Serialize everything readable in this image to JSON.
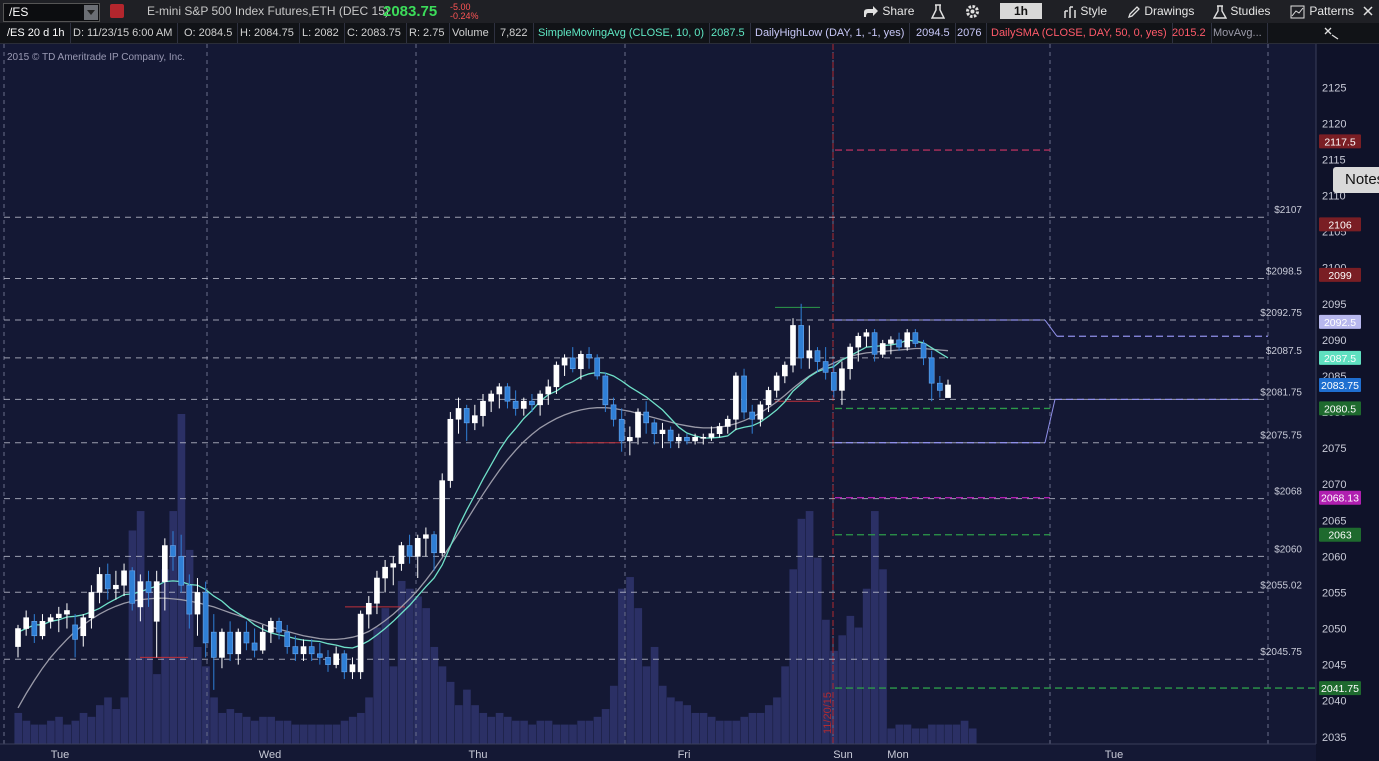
{
  "toolbar": {
    "symbol": "/ES",
    "description": "E-mini S&P 500 Index Futures,ETH (DEC 15)",
    "last_price": "2083.75",
    "net_change": "-5.00",
    "pct_change": "-0.24%",
    "share_label": "Share",
    "timeframe": "1h",
    "style_label": "Style",
    "drawings_label": "Drawings",
    "studies_label": "Studies",
    "patterns_label": "Patterns"
  },
  "status": {
    "period": "/ES 20 d 1h",
    "date": "D: 11/23/15 6:00 AM",
    "open": "O: 2084.5",
    "high": "H: 2084.75",
    "low": "L: 2082",
    "close": "C: 2083.75",
    "range": "R: 2.75",
    "volume_label": "Volume",
    "volume_value": "7,822",
    "sma_label": "SimpleMovingAvg (CLOSE, 10, 0)",
    "sma_value": "2087.5",
    "dhl_label": "DailyHighLow (DAY, 1, -1, yes)",
    "dhl_high": "2094.5",
    "dhl_low": "2076",
    "dsma_label": "DailySMA (CLOSE, DAY, 50, 0, yes)",
    "dsma_value": "2015.2",
    "movavg_label": "MovAvg..."
  },
  "copyright": "2015 © TD Ameritrade IP Company, Inc.",
  "notes_label": "Notes",
  "colors": {
    "background": "#141834",
    "up_candle": "#ffffff",
    "down_candle": "#2f7fd6",
    "volume": "#2b3065",
    "sma10": "#6fe0c8",
    "sma_slow": "#9a9aa8",
    "red_marker": "#c0303a",
    "green_marker": "#2c9a4a"
  },
  "chart_data": {
    "type": "candlestick",
    "symbol": "/ES",
    "interval": "1h",
    "ylim": [
      2034,
      2131
    ],
    "y_ticks": [
      2035,
      2040,
      2045,
      2050,
      2055,
      2060,
      2065,
      2070,
      2075,
      2080,
      2085,
      2090,
      2095,
      2100,
      2105,
      2110,
      2115,
      2120,
      2125
    ],
    "x_ticks": [
      "Tue",
      "Wed",
      "Thu",
      "Fri",
      "Sun",
      "Mon",
      "Tue"
    ],
    "date_marker": "11/20/15",
    "levels": [
      {
        "label": "$2107",
        "value": 2107
      },
      {
        "label": "$2098.5",
        "value": 2098.5
      },
      {
        "label": "$2092.75",
        "value": 2092.75
      },
      {
        "label": "$2087.5",
        "value": 2087.5
      },
      {
        "label": "$2081.75",
        "value": 2081.75
      },
      {
        "label": "$2075.75",
        "value": 2075.75
      },
      {
        "label": "$2068",
        "value": 2068
      },
      {
        "label": "$2060",
        "value": 2060
      },
      {
        "label": "$2055.02",
        "value": 2055.02
      },
      {
        "label": "$2045.75",
        "value": 2045.75
      }
    ],
    "price_tags": [
      {
        "label": "2117.5",
        "value": 2117.5,
        "color": "#7a1e24"
      },
      {
        "label": "2106",
        "value": 2106,
        "color": "#7a1e24"
      },
      {
        "label": "2099",
        "value": 2099,
        "color": "#7a1e24"
      },
      {
        "label": "2092.5",
        "value": 2092.5,
        "color": "#b8b8ee"
      },
      {
        "label": "2087.5",
        "value": 2087.5,
        "color": "#5fe0c0"
      },
      {
        "label": "2083.75",
        "value": 2083.75,
        "color": "#1f6fd0"
      },
      {
        "label": "2080.5",
        "value": 2080.5,
        "color": "#1e6a2e"
      },
      {
        "label": "2068.13",
        "value": 2068.13,
        "color": "#b01fb0"
      },
      {
        "label": "2063",
        "value": 2063,
        "color": "#1e6a2e"
      },
      {
        "label": "2041.75",
        "value": 2041.75,
        "color": "#1e6a2e"
      }
    ],
    "candles": [
      [
        2047.5,
        2050.5,
        2046,
        2050
      ],
      [
        2050,
        2052.5,
        2049,
        2051.5
      ],
      [
        2051,
        2052,
        2048,
        2049
      ],
      [
        2049,
        2052,
        2048.5,
        2051
      ],
      [
        2051,
        2052,
        2050,
        2051.5
      ],
      [
        2051.5,
        2053,
        2049.5,
        2052
      ],
      [
        2052,
        2053.5,
        2050,
        2052.5
      ],
      [
        2050.5,
        2052,
        2046,
        2048.5
      ],
      [
        2049,
        2052,
        2047.5,
        2051.5
      ],
      [
        2051.5,
        2056,
        2050,
        2055
      ],
      [
        2055,
        2058.5,
        2053.5,
        2057.5
      ],
      [
        2057.5,
        2059,
        2054,
        2055.5
      ],
      [
        2055.5,
        2058,
        2054,
        2056
      ],
      [
        2056,
        2059,
        2054.5,
        2058
      ],
      [
        2058,
        2058.5,
        2052.5,
        2053.5
      ],
      [
        2053,
        2057.5,
        2051,
        2056.5
      ],
      [
        2056.5,
        2058,
        2053,
        2055
      ],
      [
        2051,
        2058,
        2046,
        2056.5
      ],
      [
        2056.5,
        2062.5,
        2052.5,
        2061.5
      ],
      [
        2061.5,
        2063.5,
        2058,
        2060
      ],
      [
        2060,
        2063,
        2055,
        2056
      ],
      [
        2056,
        2057.5,
        2050,
        2052
      ],
      [
        2052,
        2057,
        2049,
        2055
      ],
      [
        2055,
        2056.5,
        2046,
        2048
      ],
      [
        2049.5,
        2052,
        2041.5,
        2046
      ],
      [
        2046,
        2050,
        2044.5,
        2049.5
      ],
      [
        2049.5,
        2051,
        2045.5,
        2046.5
      ],
      [
        2046.5,
        2050,
        2045,
        2049.5
      ],
      [
        2049.5,
        2051,
        2047,
        2048
      ],
      [
        2048,
        2050,
        2046,
        2047
      ],
      [
        2047,
        2050.5,
        2046.5,
        2049.5
      ],
      [
        2049.5,
        2051.5,
        2048,
        2051
      ],
      [
        2051,
        2051.5,
        2048.5,
        2049.5
      ],
      [
        2049.5,
        2050.5,
        2046.5,
        2047.5
      ],
      [
        2047.5,
        2049,
        2045.5,
        2046.5
      ],
      [
        2046.5,
        2048.5,
        2045.5,
        2047.5
      ],
      [
        2047.5,
        2048.5,
        2045.5,
        2046.5
      ],
      [
        2046.5,
        2048,
        2045,
        2046
      ],
      [
        2046,
        2047,
        2044,
        2045
      ],
      [
        2045,
        2047.5,
        2044.5,
        2046.5
      ],
      [
        2046.5,
        2047,
        2043,
        2044
      ],
      [
        2044,
        2046,
        2043,
        2045
      ],
      [
        2044,
        2052.5,
        2043,
        2052
      ],
      [
        2052,
        2054.5,
        2050,
        2053.5
      ],
      [
        2053.5,
        2058,
        2052,
        2057
      ],
      [
        2057,
        2059.5,
        2055,
        2058.5
      ],
      [
        2058.5,
        2060,
        2056,
        2059
      ],
      [
        2059,
        2062,
        2058,
        2061.5
      ],
      [
        2061.5,
        2063,
        2059,
        2060
      ],
      [
        2060,
        2063,
        2057,
        2062.5
      ],
      [
        2062.5,
        2064,
        2060,
        2063
      ],
      [
        2063,
        2063.5,
        2058,
        2060.5
      ],
      [
        2060.5,
        2071.5,
        2060,
        2070.5
      ],
      [
        2070.5,
        2080,
        2069.5,
        2079
      ],
      [
        2079,
        2082,
        2077,
        2080.5
      ],
      [
        2080.5,
        2081,
        2076,
        2078.5
      ],
      [
        2078.5,
        2081,
        2077.5,
        2079.5
      ],
      [
        2079.5,
        2082.5,
        2078,
        2081.5
      ],
      [
        2081.5,
        2083,
        2080,
        2082.5
      ],
      [
        2082.5,
        2084,
        2080.5,
        2083.5
      ],
      [
        2083.5,
        2084,
        2080.5,
        2081.5
      ],
      [
        2081.5,
        2083,
        2079.5,
        2080.5
      ],
      [
        2080.5,
        2082,
        2079.5,
        2081.5
      ],
      [
        2081.5,
        2082.5,
        2080,
        2081
      ],
      [
        2081,
        2083,
        2079.5,
        2082.5
      ],
      [
        2082.5,
        2084.5,
        2081,
        2083.5
      ],
      [
        2083.5,
        2087,
        2082.5,
        2086.5
      ],
      [
        2086.5,
        2088,
        2085,
        2087.5
      ],
      [
        2087.5,
        2089,
        2085.5,
        2086
      ],
      [
        2086,
        2088.5,
        2084.5,
        2088
      ],
      [
        2088,
        2089,
        2086,
        2087.5
      ],
      [
        2087.5,
        2088,
        2084.5,
        2085
      ],
      [
        2085,
        2085.5,
        2080,
        2081
      ],
      [
        2081,
        2082,
        2078,
        2079
      ],
      [
        2079,
        2080.5,
        2074.5,
        2076
      ],
      [
        2076,
        2078,
        2074,
        2076.5
      ],
      [
        2076.5,
        2080.5,
        2075.5,
        2080
      ],
      [
        2080,
        2081.5,
        2077,
        2078.5
      ],
      [
        2078.5,
        2079,
        2075.5,
        2077
      ],
      [
        2077,
        2078.5,
        2075,
        2077.5
      ],
      [
        2077.5,
        2078,
        2075,
        2076
      ],
      [
        2076,
        2077,
        2075,
        2076.5
      ],
      [
        2076.5,
        2077,
        2075.5,
        2076
      ],
      [
        2076,
        2077,
        2075.5,
        2076.5
      ],
      [
        2076.5,
        2077,
        2075.5,
        2076.5
      ],
      [
        2076.5,
        2078,
        2076,
        2077
      ],
      [
        2077,
        2078.5,
        2076.5,
        2078
      ],
      [
        2078,
        2079.5,
        2077,
        2079
      ],
      [
        2079,
        2085.5,
        2077.5,
        2085
      ],
      [
        2085,
        2086,
        2079,
        2080
      ],
      [
        2080,
        2081,
        2077,
        2079
      ],
      [
        2079,
        2081.5,
        2078,
        2081
      ],
      [
        2081,
        2083.5,
        2080,
        2083
      ],
      [
        2083,
        2085.5,
        2082,
        2085
      ],
      [
        2085,
        2087,
        2084,
        2086.5
      ],
      [
        2086.5,
        2093,
        2085.5,
        2092
      ],
      [
        2092,
        2095,
        2086,
        2087.5
      ],
      [
        2087.5,
        2092,
        2086,
        2088.5
      ],
      [
        2088.5,
        2089,
        2085.5,
        2087
      ],
      [
        2087,
        2089,
        2084.5,
        2085.5
      ],
      [
        2085.5,
        2087,
        2082,
        2083
      ],
      [
        2083,
        2087,
        2081,
        2086
      ],
      [
        2086,
        2089.5,
        2084.5,
        2089
      ],
      [
        2089,
        2091,
        2087,
        2090.5
      ],
      [
        2090.5,
        2091.5,
        2089,
        2091
      ],
      [
        2091,
        2091.5,
        2087,
        2088
      ],
      [
        2088,
        2090,
        2087.5,
        2089.5
      ],
      [
        2089.5,
        2090.5,
        2088,
        2090
      ],
      [
        2090,
        2091,
        2088.5,
        2089
      ],
      [
        2089,
        2091.5,
        2088.5,
        2091
      ],
      [
        2091,
        2091.5,
        2089,
        2089.5
      ],
      [
        2089.5,
        2090,
        2086.5,
        2087.5
      ],
      [
        2087.5,
        2088.5,
        2081.5,
        2084
      ],
      [
        2084,
        2085,
        2082,
        2083
      ],
      [
        2082,
        2084.5,
        2082,
        2083.75
      ]
    ],
    "volume": [
      8,
      6,
      5,
      5,
      6,
      7,
      5,
      6,
      8,
      7,
      10,
      12,
      9,
      12,
      55,
      60,
      40,
      18,
      45,
      60,
      85,
      50,
      25,
      20,
      12,
      8,
      9,
      8,
      7,
      6,
      7,
      7,
      6,
      6,
      5,
      5,
      5,
      5,
      5,
      5,
      6,
      7,
      8,
      12,
      30,
      35,
      20,
      42,
      40,
      38,
      35,
      25,
      20,
      16,
      10,
      14,
      10,
      8,
      7,
      8,
      7,
      6,
      6,
      5,
      6,
      6,
      5,
      5,
      5,
      6,
      6,
      7,
      9,
      15,
      40,
      43,
      35,
      20,
      25,
      15,
      12,
      11,
      10,
      8,
      8,
      7,
      6,
      6,
      6,
      7,
      8,
      8,
      10,
      12,
      20,
      45,
      58,
      60,
      48,
      32,
      24,
      28,
      33,
      30,
      40,
      60,
      45,
      4,
      5,
      5,
      4,
      4,
      5,
      5,
      5,
      5,
      6,
      4
    ],
    "sma10": [
      2049.5,
      2050,
      2050.5,
      2050.5,
      2051,
      2051.2,
      2051.6,
      2051.7,
      2051.9,
      2052.3,
      2052.8,
      2053.5,
      2054.1,
      2054.7,
      2054.8,
      2055.1,
      2055.5,
      2055.9,
      2056.5,
      2056.6,
      2056.5,
      2056.1,
      2056,
      2055.4,
      2054.5,
      2053.8,
      2052.8,
      2052.1,
      2051.4,
      2050.5,
      2049.9,
      2049.4,
      2049.1,
      2048.9,
      2048.6,
      2048.4,
      2048.3,
      2048.2,
      2047.9,
      2047.7,
      2047.4,
      2047.3,
      2047.7,
      2048.3,
      2049.1,
      2050,
      2051,
      2052.1,
      2053.2,
      2054.5,
      2055.8,
      2057,
      2058.8,
      2061.4,
      2064.1,
      2066.4,
      2068.5,
      2070.7,
      2072.7,
      2074.7,
      2076.4,
      2077.7,
      2079.1,
      2080.2,
      2081.5,
      2082.4,
      2082.9,
      2083.7,
      2084.2,
      2084.9,
      2085.3,
      2085.5,
      2085.4,
      2085,
      2084.3,
      2083.5,
      2082.8,
      2082.1,
      2081.2,
      2080.3,
      2079.1,
      2077.9,
      2077.1,
      2076.7,
      2076.4,
      2076.4,
      2076.5,
      2076.7,
      2077.6,
      2077.9,
      2078.1,
      2078.6,
      2079.4,
      2080.3,
      2081.4,
      2082.9,
      2083.9,
      2084.9,
      2085.6,
      2086,
      2086.3,
      2087.2,
      2087.8,
      2088.4,
      2089,
      2089.1,
      2089.2,
      2089.3,
      2089.5,
      2090,
      2089.8,
      2089.6,
      2088.9,
      2088.2,
      2087.5
    ],
    "sma_slow": [
      2039,
      2041,
      2042.8,
      2044.5,
      2046,
      2047.3,
      2048.5,
      2049.6,
      2050.5,
      2051.3,
      2052,
      2052.6,
      2053.1,
      2053.5,
      2053.8,
      2054,
      2054.1,
      2054.2,
      2054.2,
      2054.1,
      2054,
      2053.8,
      2053.6,
      2053.3,
      2053,
      2052.6,
      2052.2,
      2051.8,
      2051.4,
      2051,
      2050.6,
      2050.2,
      2049.9,
      2049.6,
      2049.3,
      2049,
      2048.8,
      2048.6,
      2048.5,
      2048.5,
      2048.6,
      2048.8,
      2049.1,
      2049.6,
      2050.3,
      2051.1,
      2052,
      2053,
      2054.1,
      2055.3,
      2056.7,
      2058.2,
      2059.8,
      2061.5,
      2063.2,
      2065,
      2066.8,
      2068.6,
      2070.3,
      2071.9,
      2073.4,
      2074.7,
      2075.9,
      2076.9,
      2077.8,
      2078.5,
      2079.1,
      2079.6,
      2080,
      2080.3,
      2080.5,
      2080.6,
      2080.6,
      2080.5,
      2080.3,
      2080.1,
      2079.8,
      2079.5,
      2079.2,
      2078.9,
      2078.6,
      2078.3,
      2078.1,
      2077.9,
      2077.8,
      2077.8,
      2077.9,
      2078.1,
      2078.4,
      2078.8,
      2079.3,
      2079.9,
      2080.6,
      2081.4,
      2082.3,
      2083.3,
      2084.2,
      2085,
      2085.7,
      2086.3,
      2086.8,
      2087.3,
      2087.7,
      2088,
      2088.2,
      2088.3,
      2088.4,
      2088.5,
      2088.6,
      2088.7,
      2088.8,
      2088.8,
      2088.7,
      2088.6,
      2088.5
    ]
  }
}
